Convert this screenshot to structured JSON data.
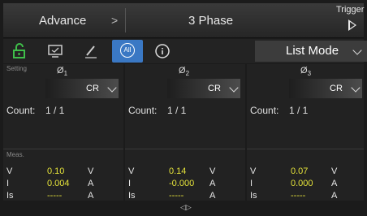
{
  "header": {
    "advance": "Advance",
    "chevron": ">",
    "mode": "3 Phase",
    "trigger": "Trigger"
  },
  "toolbar": {
    "icons": [
      "unlock-icon",
      "monitor-icon",
      "pen-icon",
      "all-icon",
      "info-icon"
    ],
    "all_label": "All",
    "info_label": "i",
    "list_mode": "List Mode"
  },
  "setting_label": "Setting",
  "meas_label": "Meas.",
  "phases": [
    {
      "name": "Ø",
      "sub": "1",
      "mode": "CR",
      "count_label": "Count:",
      "count": "1 / 1",
      "meas": [
        {
          "n": "V",
          "v": "0.10",
          "u": "V"
        },
        {
          "n": "I",
          "v": "0.004",
          "u": "A"
        },
        {
          "n": "Is",
          "v": "-----",
          "u": "A"
        }
      ]
    },
    {
      "name": "Ø",
      "sub": "2",
      "mode": "CR",
      "count_label": "Count:",
      "count": "1 / 1",
      "meas": [
        {
          "n": "V",
          "v": "0.14",
          "u": "V"
        },
        {
          "n": "I",
          "v": "-0.000",
          "u": "A"
        },
        {
          "n": "Is",
          "v": "-----",
          "u": "A"
        }
      ]
    },
    {
      "name": "Ø",
      "sub": "3",
      "mode": "CR",
      "count_label": "Count:",
      "count": "1 / 1",
      "meas": [
        {
          "n": "V",
          "v": "0.07",
          "u": "V"
        },
        {
          "n": "I",
          "v": "0.000",
          "u": "A"
        },
        {
          "n": "Is",
          "v": "-----",
          "u": "A"
        }
      ]
    }
  ],
  "bottom_icon": "◁▷",
  "colors": {
    "accent": "#3a78c4",
    "value": "#e4e23a",
    "unlock": "#3fbf4a"
  }
}
